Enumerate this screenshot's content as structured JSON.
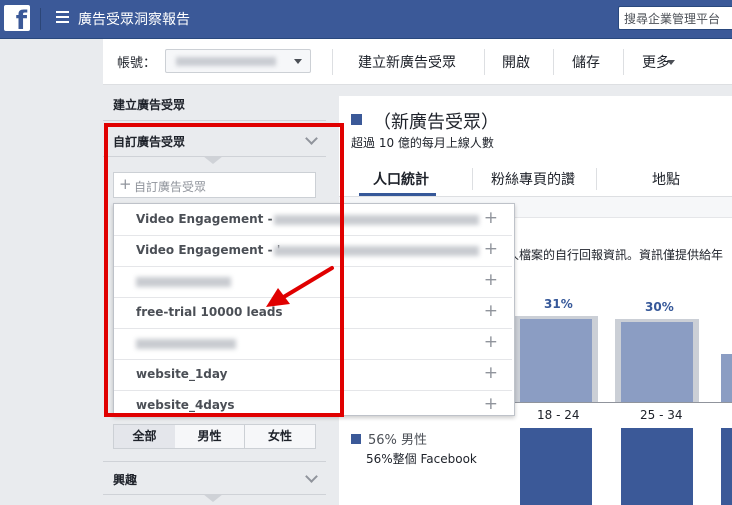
{
  "topbar": {
    "logo_letter": "f",
    "title": "廣告受眾洞察報告",
    "search_placeholder": "搜尋企業管理平台"
  },
  "toolbar": {
    "account_label": "帳號：",
    "create_audience": "建立新廣告受眾",
    "open": "開啟",
    "save": "儲存",
    "more": "更多"
  },
  "left_panel": {
    "create_audience_heading": "建立廣告受眾",
    "custom_audience_heading": "自訂廣告受眾",
    "custom_audience_placeholder": "自訂廣告受眾",
    "gender": {
      "all": "全部",
      "male": "男性",
      "female": "女性"
    },
    "interests_heading": "興趣"
  },
  "dropdown": {
    "items": [
      {
        "label": "Video Engagement - ",
        "blurred": true
      },
      {
        "label": "Video Engagement - '",
        "blurred": true
      },
      {
        "label": "",
        "blurred": true
      },
      {
        "label": "free-trial 10000 leads",
        "blurred": false
      },
      {
        "label": "",
        "blurred": true
      },
      {
        "label": "website_1day",
        "blurred": false
      },
      {
        "label": "website_4days",
        "blurred": false
      }
    ],
    "add_symbol": "+"
  },
  "main": {
    "title": "（新廣告受眾）",
    "subtitle": "超過 10 億的每月上線人數",
    "tabs": [
      "人口統計",
      "粉絲專頁的讚",
      "地點"
    ],
    "active_tab": 0,
    "note": "人檔案的自行回報資訊。資訊僅提供給年",
    "male_summary": "56% 男性",
    "male_sub": "56%整個 Facebook"
  },
  "chart_data": {
    "type": "bar",
    "categories": [
      "18 - 24",
      "25 - 34"
    ],
    "series": [
      {
        "values": [
          31,
          30
        ]
      }
    ]
  },
  "colors": {
    "facebook_blue": "#3b5998",
    "bar_light": "#8b9dc3",
    "highlight_red": "#e00000"
  }
}
